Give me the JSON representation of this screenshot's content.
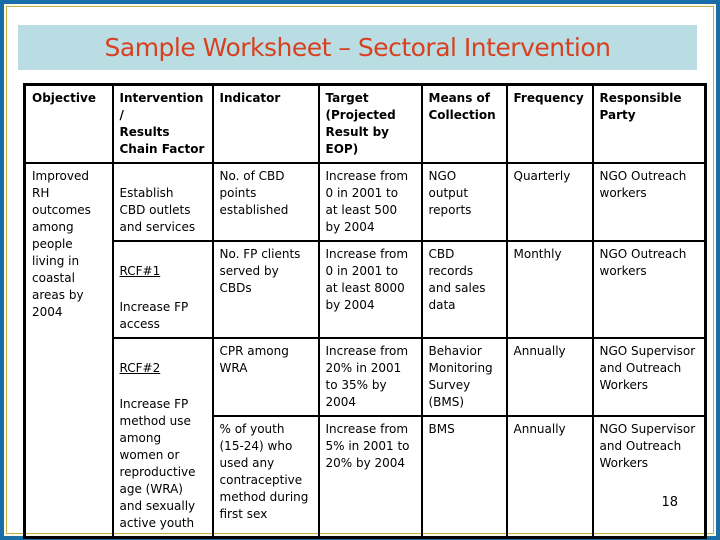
{
  "slide": {
    "title": "Sample Worksheet – Sectoral Intervention",
    "page_number": "18"
  },
  "table": {
    "headers": [
      "Objective",
      "Intervention\n/\nResults\nChain Factor",
      "Indicator",
      "Target\n(Projected\nResult by\nEOP)",
      "Means of\nCollection",
      "Frequency",
      "Responsible\nParty"
    ],
    "objective": "Improved\nRH\noutcomes\namong\npeople\nliving in\ncoastal\nareas by\n2004",
    "interventions": [
      {
        "code": "",
        "text": "Establish\nCBD outlets\nand services"
      },
      {
        "code": "RCF#1",
        "text": "Increase FP\naccess"
      },
      {
        "code": "RCF#2",
        "text": "Increase FP\nmethod use\namong\nwomen or\nreproductive\nage (WRA)\nand sexually\nactive youth"
      }
    ],
    "rows": [
      {
        "indicator": "No. of CBD\npoints\nestablished",
        "target": "Increase from\n0 in 2001 to\nat least 500\nby 2004",
        "means": "NGO\noutput\nreports",
        "frequency": "Quarterly",
        "responsible": "NGO Outreach\nworkers"
      },
      {
        "indicator": "No. FP clients\nserved by\nCBDs",
        "target": "Increase from\n0 in 2001 to\nat least 8000\nby 2004",
        "means": "CBD\nrecords\nand sales\ndata",
        "frequency": "Monthly",
        "responsible": "NGO Outreach\nworkers"
      },
      {
        "indicator": "CPR among\nWRA",
        "target": "Increase from\n20% in 2001\nto 35% by\n2004",
        "means": "Behavior\nMonitoring\nSurvey\n(BMS)",
        "frequency": "Annually",
        "responsible": "NGO Supervisor\nand Outreach\nWorkers"
      },
      {
        "indicator": "% of youth\n(15-24) who\nused any\ncontraceptive\nmethod during\nfirst sex",
        "target": "Increase from\n5% in 2001 to\n20% by 2004",
        "means": "BMS",
        "frequency": "Annually",
        "responsible": "NGO Supervisor\nand Outreach\nWorkers"
      }
    ]
  }
}
